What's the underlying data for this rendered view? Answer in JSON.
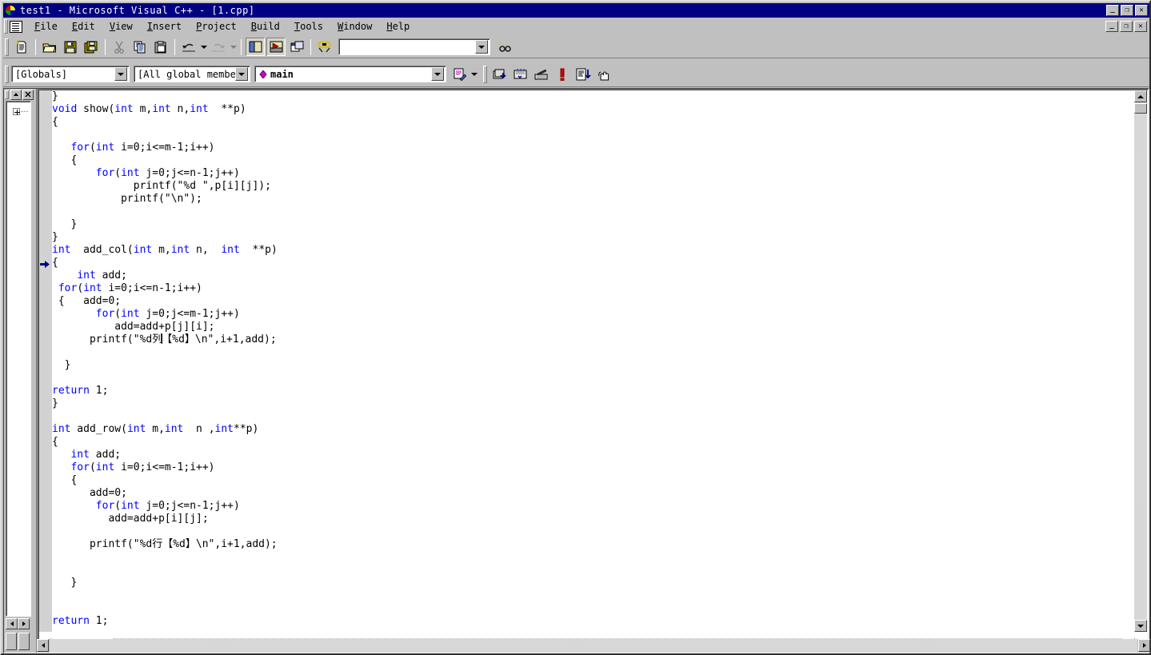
{
  "window": {
    "title": "test1 - Microsoft Visual C++ - [1.cpp]",
    "sys_icon": "vc-app-icon",
    "buttons": {
      "minimize": "_",
      "restore": "❐",
      "close": "✕"
    }
  },
  "mdi_child": {
    "buttons": {
      "minimize": "_",
      "restore": "❐",
      "close": "✕"
    }
  },
  "menu": {
    "doc_icon": "document-icon",
    "items": [
      {
        "label": "File",
        "mnemonic": "F"
      },
      {
        "label": "Edit",
        "mnemonic": "E"
      },
      {
        "label": "View",
        "mnemonic": "V"
      },
      {
        "label": "Insert",
        "mnemonic": "I"
      },
      {
        "label": "Project",
        "mnemonic": "P"
      },
      {
        "label": "Build",
        "mnemonic": "B"
      },
      {
        "label": "Tools",
        "mnemonic": "T"
      },
      {
        "label": "Window",
        "mnemonic": "W"
      },
      {
        "label": "Help",
        "mnemonic": "H"
      }
    ]
  },
  "toolbar_standard": {
    "buttons": [
      {
        "name": "new-text-file-icon",
        "tooltip": "New Text File"
      },
      {
        "name": "open-icon",
        "tooltip": "Open"
      },
      {
        "name": "save-icon",
        "tooltip": "Save"
      },
      {
        "name": "save-all-icon",
        "tooltip": "Save All"
      },
      {
        "name": "cut-icon",
        "tooltip": "Cut"
      },
      {
        "name": "copy-icon",
        "tooltip": "Copy"
      },
      {
        "name": "paste-icon",
        "tooltip": "Paste"
      },
      {
        "name": "undo-icon",
        "tooltip": "Undo"
      },
      {
        "name": "redo-icon",
        "tooltip": "Redo"
      },
      {
        "name": "workspace-toggle-icon",
        "tooltip": "Workspace"
      },
      {
        "name": "output-toggle-icon",
        "tooltip": "Output"
      },
      {
        "name": "window-list-icon",
        "tooltip": "Window List"
      },
      {
        "name": "find-in-files-icon",
        "tooltip": "Find in Files"
      }
    ],
    "find_box": {
      "value": "",
      "placeholder": ""
    },
    "help_button": "find-help-icon"
  },
  "toolbar_wizardbar": {
    "class_combo": {
      "value": "[Globals]"
    },
    "filter_combo": {
      "value": "[All global members"
    },
    "member_combo": {
      "value": "main",
      "icon": "member-function-icon"
    },
    "action_button": "wizardbar-action-icon",
    "buttons": [
      {
        "name": "compile-icon",
        "tooltip": "Compile"
      },
      {
        "name": "build-icon",
        "tooltip": "Build"
      },
      {
        "name": "stop-build-icon",
        "tooltip": "Stop Build"
      },
      {
        "name": "execute-program-icon",
        "tooltip": "Execute Program"
      },
      {
        "name": "go-icon",
        "tooltip": "Go"
      },
      {
        "name": "insert-breakpoint-icon",
        "tooltip": "Insert/Remove Breakpoint"
      }
    ]
  },
  "workspace_pane": {
    "title_buttons": [
      "workspace-collapse-icon",
      "workspace-close-icon"
    ],
    "tree_root": {
      "expander": "+",
      "label": ""
    },
    "tabs": [
      "workspace-tab-classview",
      "workspace-tab-fileview"
    ]
  },
  "editor": {
    "filename": "1.cpp",
    "breakpoint_marker": "current-statement-arrow",
    "caret_line": 21,
    "syntax_colors": {
      "keyword": "#0000ff",
      "text": "#000000",
      "background": "#ffffff"
    },
    "lines": [
      {
        "indent": "",
        "segments": [
          {
            "t": "}",
            "k": false
          }
        ]
      },
      {
        "indent": "",
        "segments": [
          {
            "t": "void",
            "k": true
          },
          {
            "t": " show(",
            "k": false
          },
          {
            "t": "int",
            "k": true
          },
          {
            "t": " m,",
            "k": false
          },
          {
            "t": "int",
            "k": true
          },
          {
            "t": " n,",
            "k": false
          },
          {
            "t": "int",
            "k": true
          },
          {
            "t": "  **p)",
            "k": false
          }
        ]
      },
      {
        "indent": "",
        "segments": [
          {
            "t": "{",
            "k": false
          }
        ]
      },
      {
        "indent": "",
        "segments": [
          {
            "t": "",
            "k": false
          }
        ]
      },
      {
        "indent": "   ",
        "segments": [
          {
            "t": "for",
            "k": true
          },
          {
            "t": "(",
            "k": false
          },
          {
            "t": "int",
            "k": true
          },
          {
            "t": " i=0;i<=m-1;i++)",
            "k": false
          }
        ]
      },
      {
        "indent": "   ",
        "segments": [
          {
            "t": "{",
            "k": false
          }
        ]
      },
      {
        "indent": "       ",
        "segments": [
          {
            "t": "for",
            "k": true
          },
          {
            "t": "(",
            "k": false
          },
          {
            "t": "int",
            "k": true
          },
          {
            "t": " j=0;j<=n-1;j++)",
            "k": false
          }
        ]
      },
      {
        "indent": "             ",
        "segments": [
          {
            "t": "printf(\"%d \",p[i][j]);",
            "k": false
          }
        ]
      },
      {
        "indent": "           ",
        "segments": [
          {
            "t": "printf(\"\\n\");",
            "k": false
          }
        ]
      },
      {
        "indent": "",
        "segments": [
          {
            "t": "",
            "k": false
          }
        ]
      },
      {
        "indent": "   ",
        "segments": [
          {
            "t": "}",
            "k": false
          }
        ]
      },
      {
        "indent": "",
        "segments": [
          {
            "t": "}",
            "k": false
          }
        ]
      },
      {
        "indent": "",
        "segments": [
          {
            "t": "int",
            "k": true
          },
          {
            "t": "  add_col(",
            "k": false
          },
          {
            "t": "int",
            "k": true
          },
          {
            "t": " m,",
            "k": false
          },
          {
            "t": "int",
            "k": true
          },
          {
            "t": " n,  ",
            "k": false
          },
          {
            "t": "int",
            "k": true
          },
          {
            "t": "  **p)",
            "k": false
          }
        ]
      },
      {
        "indent": "",
        "segments": [
          {
            "t": "{",
            "k": false
          }
        ]
      },
      {
        "indent": "    ",
        "segments": [
          {
            "t": "int",
            "k": true
          },
          {
            "t": " add;",
            "k": false
          }
        ]
      },
      {
        "indent": " ",
        "segments": [
          {
            "t": "for",
            "k": true
          },
          {
            "t": "(",
            "k": false
          },
          {
            "t": "int",
            "k": true
          },
          {
            "t": " i=0;i<=n-1;i++)",
            "k": false
          }
        ]
      },
      {
        "indent": " ",
        "segments": [
          {
            "t": "{   add=0;",
            "k": false
          }
        ]
      },
      {
        "indent": "       ",
        "segments": [
          {
            "t": "for",
            "k": true
          },
          {
            "t": "(",
            "k": false
          },
          {
            "t": "int",
            "k": true
          },
          {
            "t": " j=0;j<=m-1;j++)",
            "k": false
          }
        ]
      },
      {
        "indent": "          ",
        "segments": [
          {
            "t": "add=add+p[j][i];",
            "k": false
          }
        ]
      },
      {
        "indent": "      ",
        "segments": [
          {
            "t": "printf(\"%d列",
            "k": false
          },
          {
            "t": "▐CARET▌",
            "k": false
          },
          {
            "t": "【%d】\\n\",i+1,add);",
            "k": false
          }
        ]
      },
      {
        "indent": "",
        "segments": [
          {
            "t": "",
            "k": false
          }
        ]
      },
      {
        "indent": "  ",
        "segments": [
          {
            "t": "}",
            "k": false
          }
        ]
      },
      {
        "indent": "",
        "segments": [
          {
            "t": "",
            "k": false
          }
        ]
      },
      {
        "indent": "",
        "segments": [
          {
            "t": "return",
            "k": true
          },
          {
            "t": " 1;",
            "k": false
          }
        ]
      },
      {
        "indent": "",
        "segments": [
          {
            "t": "}",
            "k": false
          }
        ]
      },
      {
        "indent": "",
        "segments": [
          {
            "t": "",
            "k": false
          }
        ]
      },
      {
        "indent": "",
        "segments": [
          {
            "t": "int",
            "k": true
          },
          {
            "t": " add_row(",
            "k": false
          },
          {
            "t": "int",
            "k": true
          },
          {
            "t": " m,",
            "k": false
          },
          {
            "t": "int",
            "k": true
          },
          {
            "t": "  n ,",
            "k": false
          },
          {
            "t": "int",
            "k": true
          },
          {
            "t": "**p)",
            "k": false
          }
        ]
      },
      {
        "indent": "",
        "segments": [
          {
            "t": "{",
            "k": false
          }
        ]
      },
      {
        "indent": "   ",
        "segments": [
          {
            "t": "int",
            "k": true
          },
          {
            "t": " add;",
            "k": false
          }
        ]
      },
      {
        "indent": "   ",
        "segments": [
          {
            "t": "for",
            "k": true
          },
          {
            "t": "(",
            "k": false
          },
          {
            "t": "int",
            "k": true
          },
          {
            "t": " i=0;i<=m-1;i++)",
            "k": false
          }
        ]
      },
      {
        "indent": "   ",
        "segments": [
          {
            "t": "{",
            "k": false
          }
        ]
      },
      {
        "indent": "      ",
        "segments": [
          {
            "t": "add=0;",
            "k": false
          }
        ]
      },
      {
        "indent": "       ",
        "segments": [
          {
            "t": "for",
            "k": true
          },
          {
            "t": "(",
            "k": false
          },
          {
            "t": "int",
            "k": true
          },
          {
            "t": " j=0;j<=n-1;j++)",
            "k": false
          }
        ]
      },
      {
        "indent": "         ",
        "segments": [
          {
            "t": "add=add+p[i][j];",
            "k": false
          }
        ]
      },
      {
        "indent": "",
        "segments": [
          {
            "t": "",
            "k": false
          }
        ]
      },
      {
        "indent": "      ",
        "segments": [
          {
            "t": "printf(\"%d行【%d】\\n\",i+1,add);",
            "k": false
          }
        ]
      },
      {
        "indent": "",
        "segments": [
          {
            "t": "",
            "k": false
          }
        ]
      },
      {
        "indent": "",
        "segments": [
          {
            "t": "",
            "k": false
          }
        ]
      },
      {
        "indent": "   ",
        "segments": [
          {
            "t": "}",
            "k": false
          }
        ]
      },
      {
        "indent": "",
        "segments": [
          {
            "t": "",
            "k": false
          }
        ]
      },
      {
        "indent": "",
        "segments": [
          {
            "t": "",
            "k": false
          }
        ]
      },
      {
        "indent": "",
        "segments": [
          {
            "t": "return",
            "k": true
          },
          {
            "t": " 1;",
            "k": false
          }
        ]
      }
    ]
  },
  "scrollbars": {
    "editor_vertical": {
      "up": "scroll-up-arrow",
      "down": "scroll-down-arrow"
    },
    "editor_horizontal": {
      "left": "scroll-left-arrow",
      "right": "scroll-right-arrow"
    }
  }
}
